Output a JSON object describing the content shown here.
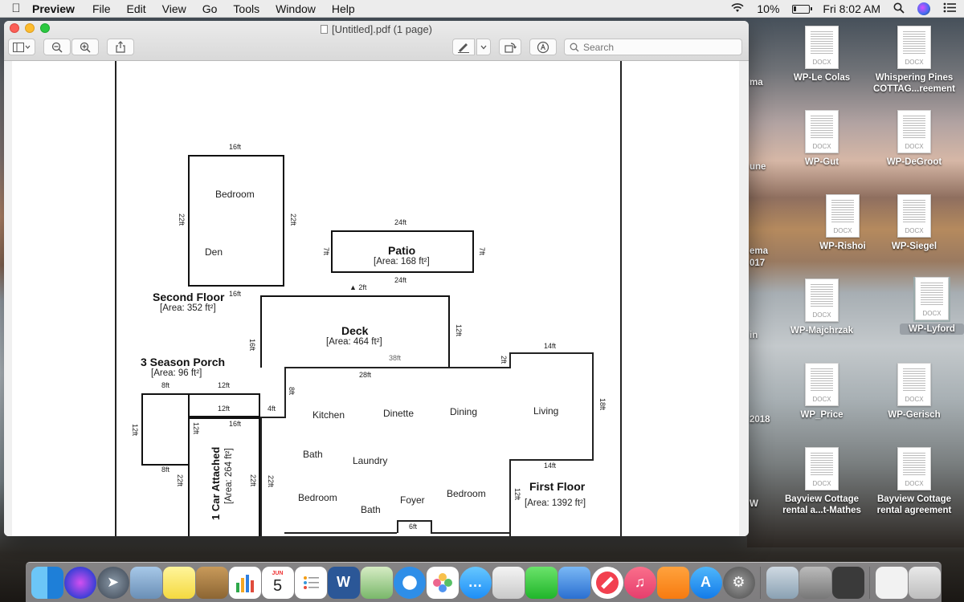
{
  "menubar": {
    "apple": "",
    "app_name": "Preview",
    "items": [
      "File",
      "Edit",
      "View",
      "Go",
      "Tools",
      "Window",
      "Help"
    ],
    "battery_percent": "10%",
    "clock": "Fri 8:02 AM"
  },
  "window": {
    "title": "[Untitled].pdf (1 page)",
    "search_placeholder": "Search"
  },
  "floorplan": {
    "second_floor": {
      "title": "Second Floor",
      "area": "[Area: 352 ft²]",
      "rooms": [
        "Bedroom",
        "Den"
      ],
      "dims": [
        "16ft",
        "22ft",
        "22ft",
        "16ft"
      ]
    },
    "patio": {
      "title": "Patio",
      "area": "[Area: 168 ft²]",
      "dims": [
        "24ft",
        "24ft",
        "7ft",
        "7ft"
      ]
    },
    "deck": {
      "title": "Deck",
      "area": "[Area: 464 ft²]",
      "dims": [
        "12ft",
        "16ft",
        "12ft",
        "38ft"
      ]
    },
    "porch": {
      "title": "3 Season Porch",
      "area": "[Area: 96 ft²]",
      "dims": [
        "8ft",
        "12ft",
        "8ft",
        "4ft",
        "12ft",
        "12ft",
        "4ft"
      ]
    },
    "garage": {
      "title": "1 Car Attached",
      "area": "[Area: 264 ft²]",
      "dims": [
        "16ft",
        "22ft",
        "12ft",
        "22ft"
      ]
    },
    "first_floor": {
      "title": "First Floor",
      "area": "[Area: 1392 ft²]",
      "rooms": [
        "Kitchen",
        "Dinette",
        "Dining",
        "Living",
        "Bath",
        "Laundry",
        "Bedroom",
        "Bath",
        "Foyer",
        "Bedroom"
      ],
      "dims": [
        "28ft",
        "14ft",
        "18ft",
        "14ft",
        "12ft",
        "8ft",
        "2ft",
        "6ft",
        "12ft",
        "22ft"
      ]
    }
  },
  "desktop": {
    "icon_ext": "DOCX",
    "icons": [
      "WP-Le Colas",
      "Whispering Pines COTTAG...reement",
      "WP-Gut",
      "WP-DeGroot",
      "WP-Rishoi",
      "WP-Siegel",
      "WP-Majchrzak",
      "WP-Lyford",
      "WP_Price",
      "WP-Gerisch",
      "Bayview Cottage rental a...t-Mathes",
      "Bayview Cottage rental agreement"
    ],
    "partial_labels": [
      "ma",
      "une",
      "ema",
      "017",
      "in",
      "2018",
      "W"
    ]
  },
  "dock": {
    "calendar_month": "JUN",
    "calendar_day": "5"
  }
}
